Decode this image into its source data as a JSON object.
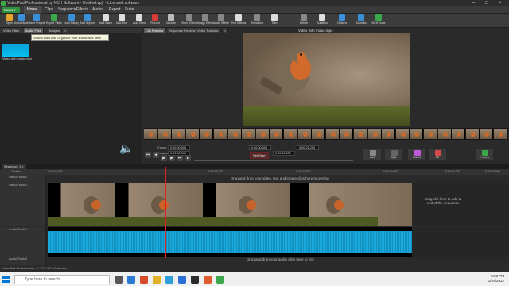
{
  "window": {
    "title": "VideoPad Professional by NCH Software - Untitled.vpj* - Licensed software"
  },
  "menu": {
    "button": "Menu ▾",
    "tabs": [
      "Home",
      "Clips",
      "Sequence",
      "Effects",
      "Audio",
      "Export",
      "Suite"
    ],
    "selected": "Home"
  },
  "toolbar": [
    {
      "label": "Open",
      "color": "#e6a52a"
    },
    {
      "label": "Video Maker",
      "color": "#3a8fd8"
    },
    {
      "label": "Save Project",
      "color": "#3a8fd8"
    },
    {
      "label": "Export Video",
      "color": "#3aa84a"
    },
    {
      "label": "Add File(s)",
      "color": "#3a8fd8"
    },
    {
      "label": "Add Objects",
      "color": "#3a8fd8"
    },
    {
      "label": "Add Blank",
      "color": "#ddd"
    },
    {
      "label": "Add Text",
      "color": "#ddd"
    },
    {
      "label": "Add Titles",
      "color": "#ddd"
    },
    {
      "label": "Record",
      "color": "#d83a3a"
    },
    {
      "label": "Narrate",
      "color": "#bbb"
    },
    {
      "label": "Video Effects",
      "color": "#888"
    },
    {
      "label": "Image Effects",
      "color": "#888"
    },
    {
      "label": "Audio Effects",
      "color": "#888"
    },
    {
      "label": "Text Effects",
      "color": "#ddd"
    },
    {
      "label": "Transition",
      "color": "#888"
    },
    {
      "label": "Trim",
      "color": "#ddd"
    },
    {
      "label": "Delete",
      "color": "#888"
    },
    {
      "label": "Subtitles",
      "color": "#ddd"
    },
    {
      "label": "Options",
      "color": "#3a8fd8"
    },
    {
      "label": "Tutorials",
      "color": "#3a8fd8"
    },
    {
      "label": "NCH Suite",
      "color": "#3aa84a"
    }
  ],
  "bin_tabs": [
    "Video Files",
    "Audio Files",
    "Images",
    "×"
  ],
  "bin_selected": "Audio Files",
  "tooltip": "Sound Files Bin. Organize your sound files here.",
  "bin_item": {
    "label": "Video with music.mp4"
  },
  "preview_tabs": [
    "Clip Preview",
    "Sequence Preview",
    "Video Tutorials",
    "×"
  ],
  "preview_selected": "Clip Preview",
  "video_title": "Video with music.mp4",
  "timecodes": {
    "current_label": "Cursor:",
    "current": "0:00:00.000",
    "start": "0:00:00.000",
    "mid": "0:00:11.200",
    "end": "0:00:21.200",
    "duration_label": "Duration:",
    "duration": "0:00:00.000"
  },
  "set_start": "Set Start",
  "right_tools": [
    {
      "label": "Add"
    },
    {
      "label": "Split"
    },
    {
      "label": "Rabbit"
    },
    {
      "label": "3D"
    },
    {
      "label": "Preview"
    }
  ],
  "sequence_tab": "Sequence 1 ×",
  "timeline_label": "Timeline",
  "ruler": [
    "0:00:00.000",
    "0:00:10.000",
    "0:00:20.000",
    "0:00:30.000",
    "0:00:40.000",
    "0:00:50.000"
  ],
  "tracks": {
    "video2": "Video Track 2",
    "video1": "Video Track 1",
    "audio1": "Audio Track 1",
    "audio2": "Audio Track 2"
  },
  "drop_video": "Drag and drop your video, text and image clips here to overlay",
  "drop_side": "Drag clip here to add to end of the sequence",
  "drop_audio": "Drag and drop your audio clips here to mix",
  "status": "VideoPad Professional v 11.22 © NCH Software",
  "taskbar": {
    "search": "Type here to search",
    "time": "5:03 PM",
    "date": "2/24/2022"
  }
}
